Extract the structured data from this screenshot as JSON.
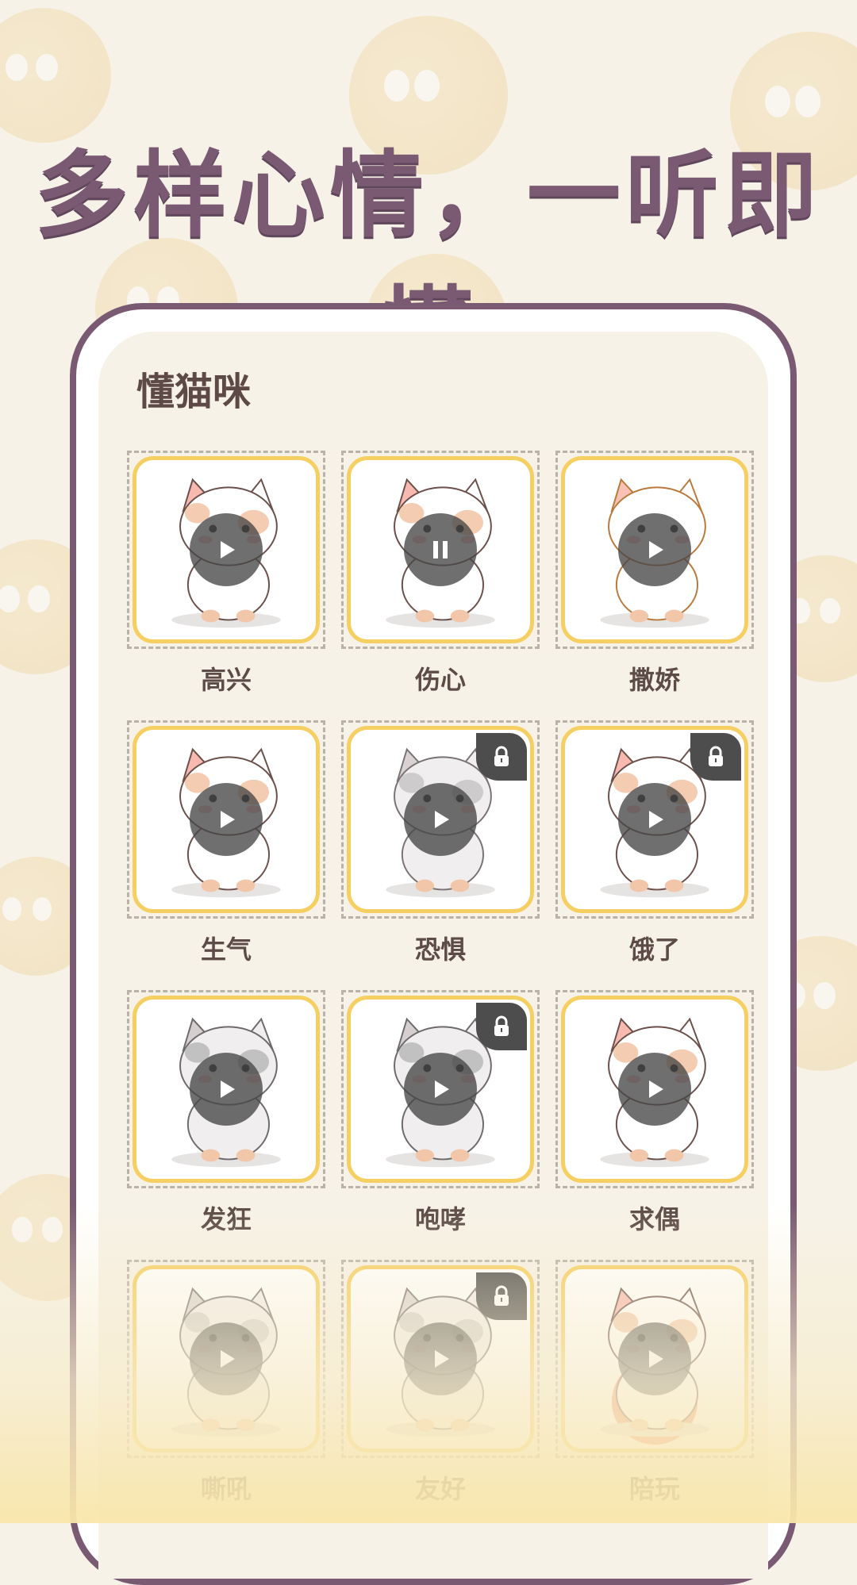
{
  "headline": "多样心情，一听即懂",
  "app": {
    "title": "懂猫咪"
  },
  "colors": {
    "accent_yellow": "#f6cf62",
    "title_purple": "#7a5a72",
    "text_brown": "#5c4b47"
  },
  "items": [
    {
      "label": "高兴",
      "state": "play",
      "locked": false,
      "icon": "play-icon"
    },
    {
      "label": "伤心",
      "state": "pause",
      "locked": false,
      "icon": "pause-icon"
    },
    {
      "label": "撒娇",
      "state": "play",
      "locked": false,
      "icon": "play-icon"
    },
    {
      "label": "生气",
      "state": "play",
      "locked": false,
      "icon": "play-icon"
    },
    {
      "label": "恐惧",
      "state": "play",
      "locked": true,
      "icon": "play-icon"
    },
    {
      "label": "饿了",
      "state": "play",
      "locked": true,
      "icon": "play-icon"
    },
    {
      "label": "发狂",
      "state": "play",
      "locked": false,
      "icon": "play-icon"
    },
    {
      "label": "咆哮",
      "state": "play",
      "locked": true,
      "icon": "play-icon"
    },
    {
      "label": "求偶",
      "state": "play",
      "locked": false,
      "icon": "play-icon"
    },
    {
      "label": "嘶吼",
      "state": "play",
      "locked": false,
      "icon": "play-icon"
    },
    {
      "label": "友好",
      "state": "play",
      "locked": true,
      "icon": "play-icon"
    },
    {
      "label": "陪玩",
      "state": "play",
      "locked": false,
      "icon": "play-icon"
    }
  ]
}
